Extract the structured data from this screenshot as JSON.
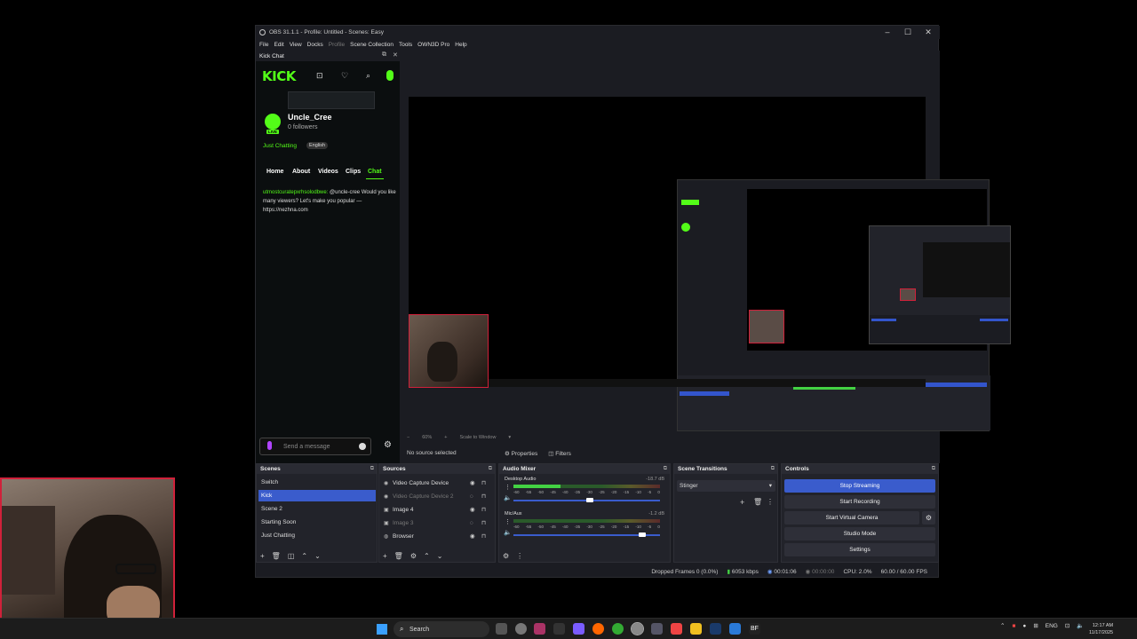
{
  "window": {
    "title": "OBS 31.1.1 - Profile: Untitled - Scenes: Easy",
    "minimize": "–",
    "maximize": "☐",
    "close": "✕"
  },
  "menu": [
    "File",
    "Edit",
    "View",
    "Docks",
    "Profile",
    "Scene Collection",
    "Tools",
    "OWN3D Pro",
    "Help"
  ],
  "kick_dock": {
    "title": "Kick Chat",
    "logo_text": "KICK",
    "channel_name": "Uncle_Cree",
    "followers": "0 followers",
    "live_badge": "LIVE",
    "category": "Just Chatting",
    "language": "English",
    "tabs": [
      "Home",
      "About",
      "Videos",
      "Clips",
      "Chat"
    ],
    "active_tab": "Chat",
    "chat": {
      "username": "utmostcuratepxrhsolodbwe:",
      "message": " @uncle-cree Would you like many viewers? Let's make you popular — https://nezhna.com"
    },
    "input_placeholder": "Send a message"
  },
  "preview": {
    "zoom": "60%",
    "scale_mode": "Scale to Window"
  },
  "source_toolbar": {
    "status": "No source selected",
    "properties": "Properties",
    "filters": "Filters"
  },
  "scenes": {
    "title": "Scenes",
    "items": [
      "Switch",
      "Kick",
      "Scene 2",
      "Starting Soon",
      "Just Chatting"
    ],
    "selected": "Kick"
  },
  "sources": {
    "title": "Sources",
    "items": [
      {
        "name": "Video Capture Device",
        "visible": true
      },
      {
        "name": "Video Capture Device 2",
        "visible": false
      },
      {
        "name": "Image 4",
        "visible": true
      },
      {
        "name": "Image 3",
        "visible": false
      },
      {
        "name": "Browser",
        "visible": true
      }
    ]
  },
  "audio_mixer": {
    "title": "Audio Mixer",
    "channels": [
      {
        "name": "Desktop Audio",
        "db": "-18.7 dB",
        "level": 0.32,
        "volume": 0.52
      },
      {
        "name": "Mic/Aux",
        "db": "-1.2 dB",
        "level": 0.0,
        "volume": 0.88
      }
    ],
    "scale": [
      "-60",
      "-55",
      "-50",
      "-45",
      "-40",
      "-35",
      "-30",
      "-25",
      "-20",
      "-15",
      "-10",
      "-5",
      "0"
    ]
  },
  "scene_transitions": {
    "title": "Scene Transitions",
    "selected": "Stinger"
  },
  "controls": {
    "title": "Controls",
    "buttons": [
      "Stop Streaming",
      "Start Recording",
      "Start Virtual Camera",
      "Studio Mode",
      "Settings"
    ]
  },
  "status_bar": {
    "dropped_frames": "Dropped Frames 0 (0.0%)",
    "bitrate": "6053 kbps",
    "stream_time": "00:01:06",
    "rec_time": "00:00:00",
    "cpu": "CPU: 2.0%",
    "fps": "60.00 / 60.00 FPS"
  },
  "taskbar": {
    "search_placeholder": "Search",
    "language": "ENG",
    "time": "12:17 AM",
    "date": "11/17/2025"
  },
  "colors": {
    "accent": "#3a5ccc",
    "kick_green": "#53fc18",
    "webcam_border": "#d0213a"
  }
}
